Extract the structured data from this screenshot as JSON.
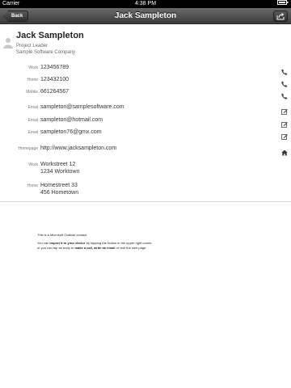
{
  "status_bar": {
    "carrier": "Carrier",
    "time": "4:38 PM"
  },
  "nav": {
    "back_label": "Back",
    "title": "Jack Sampleton"
  },
  "contact": {
    "name": "Jack Sampleton",
    "job_title": "Project Leader",
    "company": "Sample Software Company"
  },
  "phones": [
    {
      "label": "Work",
      "value": "123456789"
    },
    {
      "label": "Home",
      "value": "123432100"
    },
    {
      "label": "Mobile",
      "value": "661264567"
    }
  ],
  "emails": [
    {
      "label": "Email",
      "value": "sampleton@samplesoftware.com"
    },
    {
      "label": "Email",
      "value": "sampleton@hotmail.com"
    },
    {
      "label": "Email",
      "value": "sampleton76@gmx.com"
    }
  ],
  "homepage": {
    "label": "Homepage",
    "value": "http://www.jacksampleton.com"
  },
  "addresses": [
    {
      "label": "Work",
      "line1": "Workstreet 12",
      "line2": "1234  Worktown"
    },
    {
      "label": "Home",
      "line1": "Homestreet 33",
      "line2": "456 Hometown"
    }
  ],
  "footer": {
    "line1": "This is a Microsoft Outlook contact.",
    "p2_a": "You can ",
    "p2_b": "import it to your device",
    "p2_c": " by tapping the button in the upper right corner,",
    "p3_a": "or you can tap an entry to ",
    "p3_b": "make a call, write an email",
    "p3_c": " or visit the web page."
  },
  "colors": {
    "nav_bar": "#4a4a4a",
    "divider": "#d8d8d8"
  },
  "icons": {
    "phone": "phone-icon",
    "email": "edit-icon",
    "homepage": "home-icon",
    "share": "share-icon",
    "avatar": "person-icon"
  }
}
